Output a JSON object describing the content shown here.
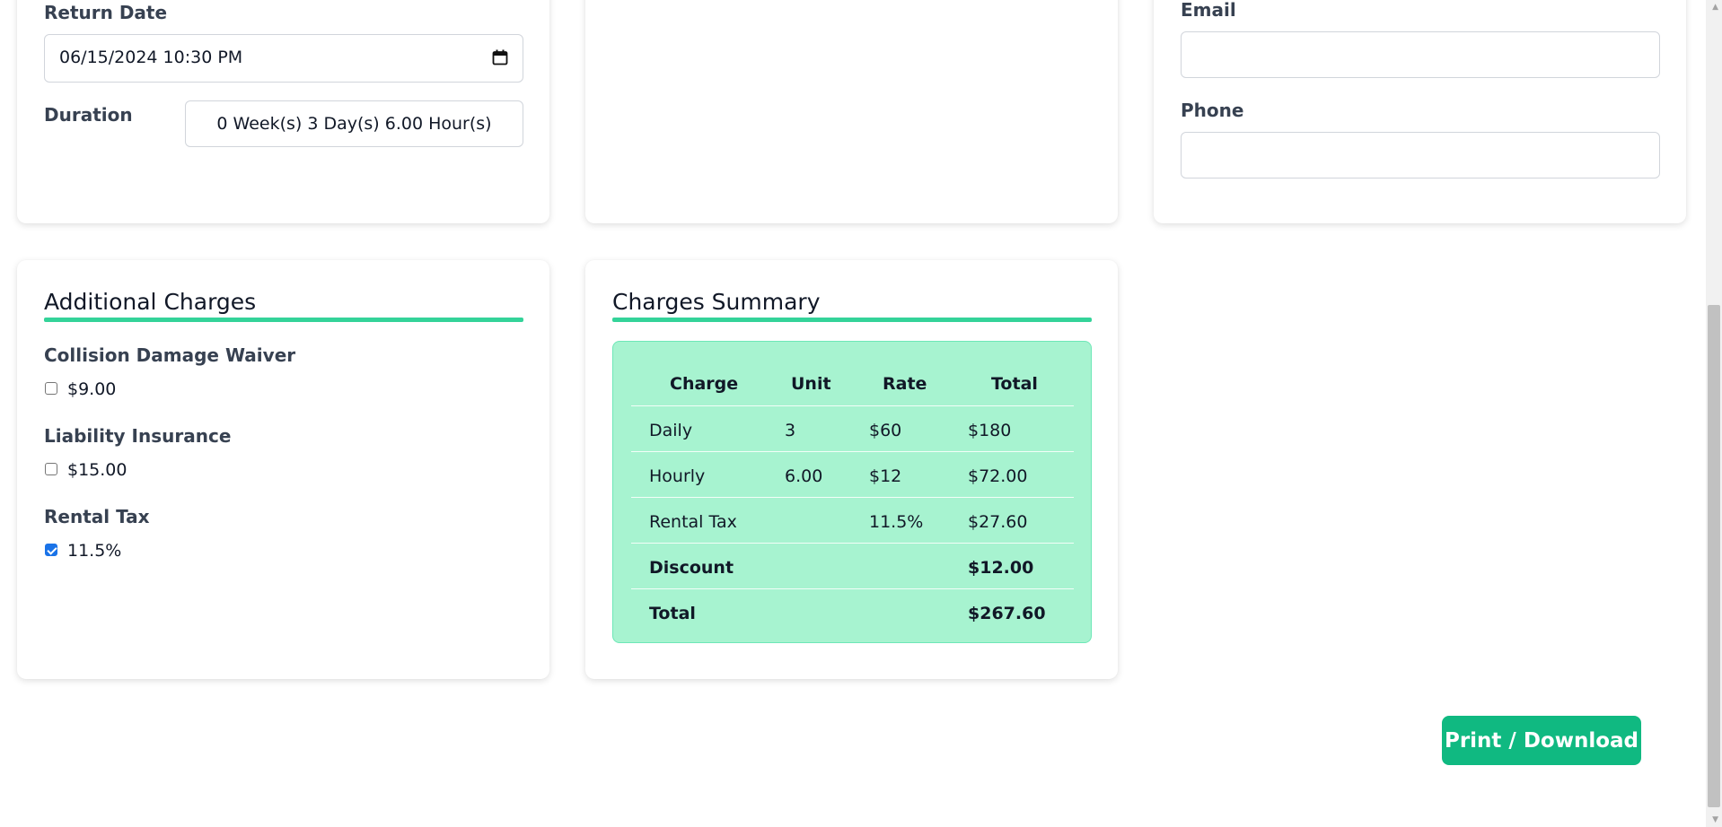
{
  "rental": {
    "return_date_label": "Return Date",
    "return_date_value": "06/15/2024 10:30 PM",
    "duration_label": "Duration",
    "duration_value": "0 Week(s) 3 Day(s) 6.00 Hour(s)"
  },
  "customer": {
    "email_label": "Email",
    "email_value": "",
    "phone_label": "Phone",
    "phone_value": ""
  },
  "additional_charges": {
    "title": "Additional Charges",
    "items": [
      {
        "name": "Collision Damage Waiver",
        "option": "$9.00",
        "checked": false
      },
      {
        "name": "Liability Insurance",
        "option": "$15.00",
        "checked": false
      },
      {
        "name": "Rental Tax",
        "option": "11.5%",
        "checked": true
      }
    ]
  },
  "summary": {
    "title": "Charges Summary",
    "headers": [
      "Charge",
      "Unit",
      "Rate",
      "Total"
    ],
    "rows": [
      {
        "charge": "Daily",
        "unit": "3",
        "rate": "$60",
        "total": "$180"
      },
      {
        "charge": "Hourly",
        "unit": "6.00",
        "rate": "$12",
        "total": "$72.00"
      },
      {
        "charge": "Rental Tax",
        "unit": "",
        "rate": "11.5%",
        "total": "$27.60"
      },
      {
        "charge": "Discount",
        "unit": "",
        "rate": "",
        "total": "$12.00"
      },
      {
        "charge": "Total",
        "unit": "",
        "rate": "",
        "total": "$267.60"
      }
    ]
  },
  "actions": {
    "print_label": "Print / Download"
  },
  "colors": {
    "accent": "#34d399",
    "summary_bg": "#a7f3d0",
    "button": "#10b981"
  }
}
